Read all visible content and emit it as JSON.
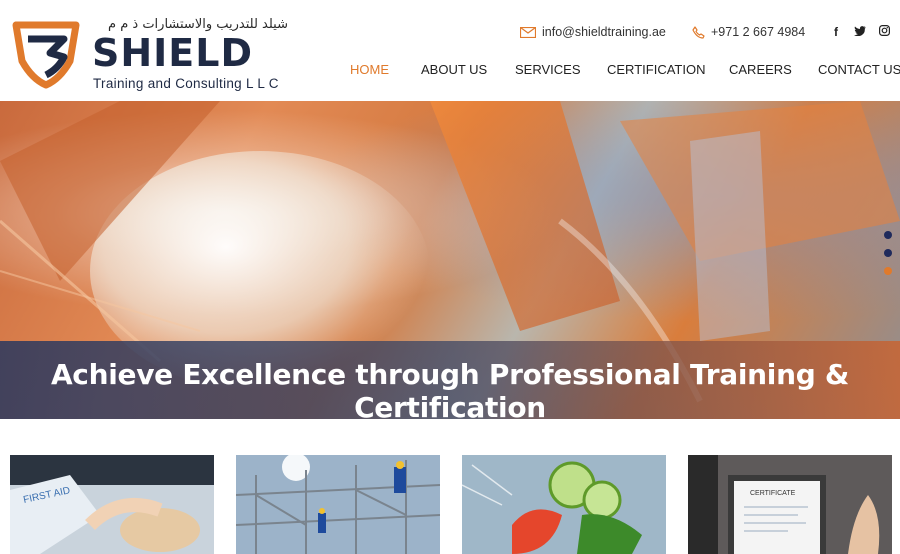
{
  "brand": {
    "arabic_name": "شيلد للتدريب والاستشارات ذ م م",
    "name": "SHIELD",
    "tagline": "Training and Consulting L L C",
    "colors": {
      "navy": "#1f2a44",
      "orange": "#e07a2c"
    }
  },
  "contact": {
    "email": "info@shieldtraining.ae",
    "email_icon": "envelope-icon",
    "phone": "+971 2 667 4984",
    "phone_icon": "phone-icon"
  },
  "socials": [
    {
      "icon": "facebook-icon",
      "glyph": "f"
    },
    {
      "icon": "twitter-icon",
      "glyph": "t"
    },
    {
      "icon": "instagram-icon",
      "glyph": "◎"
    }
  ],
  "nav": {
    "items": [
      "HOME",
      "ABOUT US",
      "SERVICES",
      "CERTIFICATION",
      "CAREERS",
      "CONTACT US"
    ],
    "active_index": 0
  },
  "hero": {
    "caption": "Achieve Excellence through Professional Training & Certification",
    "slides": 3,
    "active_slide": 2
  },
  "cards": [
    {
      "image": "first-aid-training-image"
    },
    {
      "image": "scaffolding-work-image"
    },
    {
      "image": "food-safety-image"
    },
    {
      "image": "certificate-image"
    }
  ]
}
